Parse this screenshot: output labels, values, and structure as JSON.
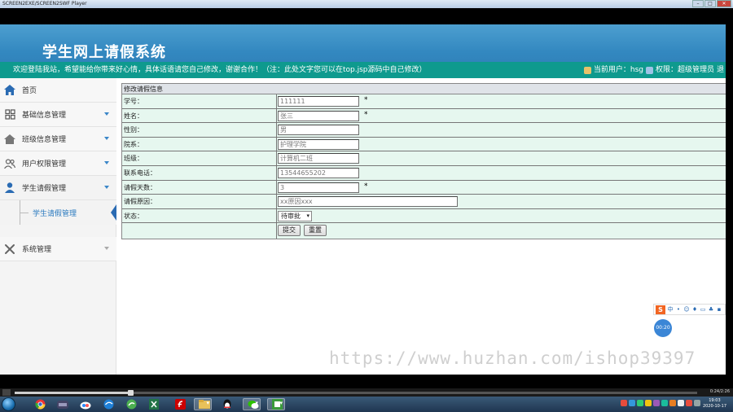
{
  "window": {
    "title": "SCREEN2EXE/SCREEN2SWF Player"
  },
  "app": {
    "title": "学生网上请假系统",
    "welcome": "欢迎登陆我站，希望能给你带来好心情，具体话语请您自己修改，谢谢合作！（注：此处文字您可以在top.jsp源码中自己修改）",
    "current_user_label": "当前用户：hsg",
    "permission_label": "权限：超级管理员",
    "logout_fragment": "退"
  },
  "sidebar": {
    "items": [
      {
        "label": "首页",
        "icon": "home-icon"
      },
      {
        "label": "基础信息管理",
        "icon": "grid-icon"
      },
      {
        "label": "班级信息管理",
        "icon": "house-icon"
      },
      {
        "label": "用户权限管理",
        "icon": "users-icon"
      },
      {
        "label": "学生请假管理",
        "icon": "user-icon"
      },
      {
        "label": "系统管理",
        "icon": "tools-icon"
      }
    ],
    "sub_items": [
      {
        "label": "学生请假管理"
      }
    ]
  },
  "form": {
    "caption": "修改请假信息",
    "fields": [
      {
        "label": "学号：",
        "value": "111111",
        "required": "*"
      },
      {
        "label": "姓名：",
        "value": "张三",
        "required": "*"
      },
      {
        "label": "性别：",
        "value": "男",
        "required": ""
      },
      {
        "label": "院系：",
        "value": "护理学院",
        "required": ""
      },
      {
        "label": "班级：",
        "value": "计算机二班",
        "required": ""
      },
      {
        "label": "联系电话：",
        "value": "13544655202",
        "required": ""
      },
      {
        "label": "请假天数：",
        "value": "3",
        "required": "*"
      },
      {
        "label": "请假原因：",
        "value": "xx原因xxx",
        "required": ""
      }
    ],
    "status": {
      "label": "状态：",
      "value": "待审批"
    },
    "submit_label": "提交",
    "reset_label": "重置"
  },
  "ime": {
    "s_label": "S",
    "cn_label": "中",
    "badge": "00:20"
  },
  "watermark": "https://www.huzhan.com/ishop39397",
  "player": {
    "progress": 0.17,
    "time": "0:24/2:26"
  },
  "taskbar": {
    "time": "19:03",
    "date": "2020-10-17"
  },
  "colors": {
    "header": "#3388c0",
    "welcome_bar": "#0e9a8e",
    "form_bg": "#e6f7ef",
    "accent": "#2a7abf"
  }
}
